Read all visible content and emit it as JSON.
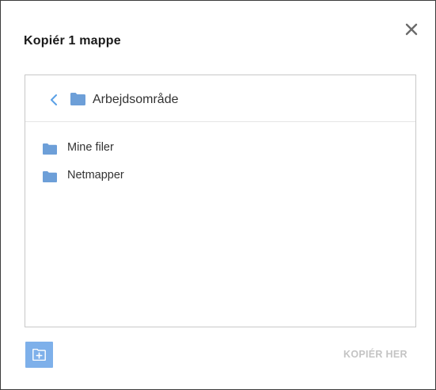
{
  "dialog": {
    "title": "Kopiér 1 mappe",
    "close_icon": "close-icon"
  },
  "browser": {
    "back_icon": "chevron-left-icon",
    "current_folder_icon": "folder-icon",
    "current_folder": "Arbejdsområde",
    "items": [
      {
        "label": "Mine filer",
        "icon": "folder-icon"
      },
      {
        "label": "Netmapper",
        "icon": "folder-icon"
      }
    ]
  },
  "footer": {
    "new_folder_icon": "new-folder-icon",
    "copy_button_label": "KOPIÉR HER",
    "copy_button_enabled": false
  },
  "colors": {
    "folder": "#6d9fd8",
    "accent": "#7eb0ea",
    "back_chevron": "#5aa0e6",
    "disabled_text": "#c4c4c4",
    "close_x": "#6b6b6b"
  }
}
